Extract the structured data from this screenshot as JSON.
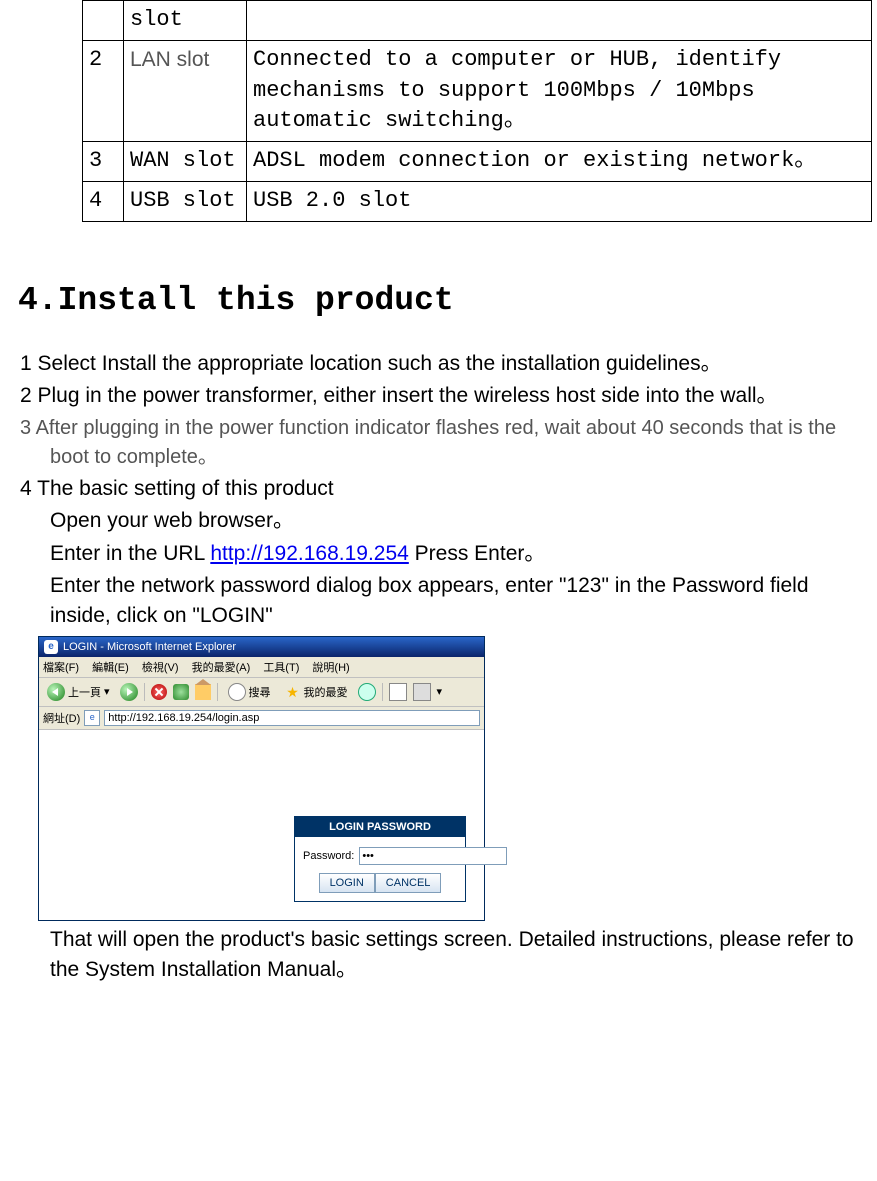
{
  "table": {
    "rows": [
      {
        "num": "",
        "name": "slot",
        "desc": ""
      },
      {
        "num": "2",
        "name": "LAN slot",
        "desc": "Connected to a computer or HUB, identify mechanisms to support 100Mbps / 10Mbps automatic switching。"
      },
      {
        "num": "3",
        "name": "WAN slot",
        "desc": "ADSL modem connection or existing network。"
      },
      {
        "num": "4",
        "name": "USB slot",
        "desc": "USB 2.0 slot"
      }
    ]
  },
  "heading": "4.Install this product",
  "steps": {
    "s1_pre": "1 Select Install the appropriate location such as the installation guidelines。",
    "s2_pre": "2    Plug in the power transformer, either insert the wireless host side into the wall。",
    "s3_pre": "3   After plugging in the power function indicator flashes red, wait about 40 seconds that is the boot to complete。",
    "s4_a": "4 The basic setting of this product",
    "s4_b": "Open your web browser。",
    "s4_c_pre": "Enter in the URL ",
    "s4_c_url": "http://192.168.19.254",
    "s4_c_post": "   Press Enter。",
    "s4_d": "Enter the network password dialog box appears, enter \"123\" in the Password field inside, click on \"LOGIN\"",
    "s4_e": "That will open the product's basic settings screen. Detailed instructions, please refer to the System Installation Manual。"
  },
  "ie": {
    "title": "LOGIN - Microsoft Internet Explorer",
    "menu": {
      "file": "檔案(F)",
      "edit": "編輯(E)",
      "view": "檢視(V)",
      "fav": "我的最愛(A)",
      "tools": "工具(T)",
      "help": "說明(H)"
    },
    "toolbar": {
      "back": "上一頁",
      "search": "搜尋",
      "favorites": "我的最愛"
    },
    "addr_label": "網址(D)",
    "addr_value": "http://192.168.19.254/login.asp",
    "login": {
      "title": "LOGIN PASSWORD",
      "label": "Password:",
      "value": "●●●",
      "btn_login": "LOGIN",
      "btn_cancel": "CANCEL"
    }
  }
}
